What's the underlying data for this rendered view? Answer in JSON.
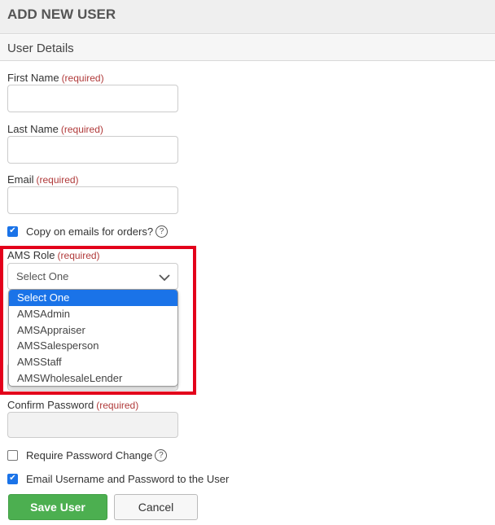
{
  "header": {
    "title": "ADD NEW USER"
  },
  "section": {
    "title": "User Details"
  },
  "required_tag": "(required)",
  "fields": {
    "first_name": {
      "label": "First Name",
      "value": ""
    },
    "last_name": {
      "label": "Last Name",
      "value": ""
    },
    "email": {
      "label": "Email",
      "value": ""
    },
    "ams_role": {
      "label": "AMS Role",
      "selected": "Select One",
      "options": [
        "Select One",
        "AMSAdmin",
        "AMSAppraiser",
        "AMSSalesperson",
        "AMSStaff",
        "AMSWholesaleLender"
      ]
    },
    "confirm_password": {
      "label": "Confirm Password",
      "value": ""
    }
  },
  "checkboxes": {
    "copy_emails": {
      "label": "Copy on emails for orders?",
      "checked": true
    },
    "require_password_change": {
      "label": "Require Password Change",
      "checked": false
    },
    "email_credentials": {
      "label": "Email Username and Password to the User",
      "checked": true
    }
  },
  "buttons": {
    "save": "Save User",
    "cancel": "Cancel"
  },
  "colors": {
    "accent": "#1a73e8",
    "save_button": "#4caf50",
    "required_text": "#b03a3a",
    "highlight_border": "#e3001b"
  },
  "icons": {
    "help": "question-circle-icon",
    "dropdown": "chevron-down-icon",
    "check": "check-icon"
  }
}
